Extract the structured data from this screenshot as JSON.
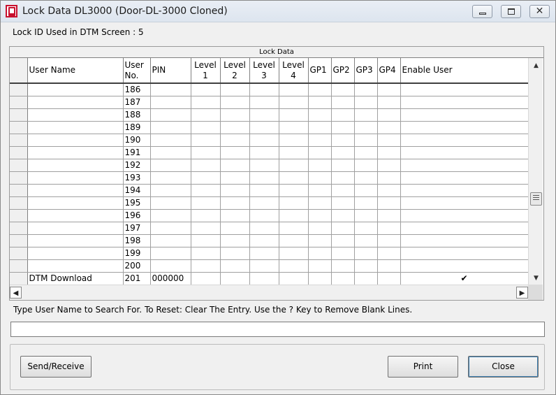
{
  "window": {
    "title": "Lock Data DL3000 (Door-DL-3000 Cloned)",
    "close_glyph": "✕"
  },
  "lock_id_label": "Lock ID Used in DTM Screen : 5",
  "grid": {
    "caption": "Lock Data",
    "headers": {
      "user_name": "User Name",
      "user_no_1": "User",
      "user_no_2": "No.",
      "pin": "PIN",
      "level1_1": "Level",
      "level1_2": "1",
      "level2_1": "Level",
      "level2_2": "2",
      "level3_1": "Level",
      "level3_2": "3",
      "level4_1": "Level",
      "level4_2": "4",
      "gp1": "GP1",
      "gp2": "GP2",
      "gp3": "GP3",
      "gp4": "GP4",
      "enable_user": "Enable User"
    },
    "rows": [
      {
        "name": "",
        "no": "186",
        "pin": "",
        "enabled": ""
      },
      {
        "name": "",
        "no": "187",
        "pin": "",
        "enabled": ""
      },
      {
        "name": "",
        "no": "188",
        "pin": "",
        "enabled": ""
      },
      {
        "name": "",
        "no": "189",
        "pin": "",
        "enabled": ""
      },
      {
        "name": "",
        "no": "190",
        "pin": "",
        "enabled": ""
      },
      {
        "name": "",
        "no": "191",
        "pin": "",
        "enabled": ""
      },
      {
        "name": "",
        "no": "192",
        "pin": "",
        "enabled": ""
      },
      {
        "name": "",
        "no": "193",
        "pin": "",
        "enabled": ""
      },
      {
        "name": "",
        "no": "194",
        "pin": "",
        "enabled": ""
      },
      {
        "name": "",
        "no": "195",
        "pin": "",
        "enabled": ""
      },
      {
        "name": "",
        "no": "196",
        "pin": "",
        "enabled": ""
      },
      {
        "name": "",
        "no": "197",
        "pin": "",
        "enabled": ""
      },
      {
        "name": "",
        "no": "198",
        "pin": "",
        "enabled": ""
      },
      {
        "name": "",
        "no": "199",
        "pin": "",
        "enabled": ""
      },
      {
        "name": "",
        "no": "200",
        "pin": "",
        "enabled": ""
      },
      {
        "name": "DTM Download",
        "no": "201",
        "pin": "000000",
        "enabled": "✔"
      }
    ],
    "scroll_up": "▲",
    "scroll_down": "▼",
    "scroll_left": "◀",
    "scroll_right": "▶"
  },
  "search": {
    "hint": "Type User Name to Search For. To Reset: Clear The Entry. Use the ? Key to Remove Blank Lines.",
    "value": ""
  },
  "buttons": {
    "send_receive": "Send/Receive",
    "print": "Print",
    "close": "Close"
  }
}
